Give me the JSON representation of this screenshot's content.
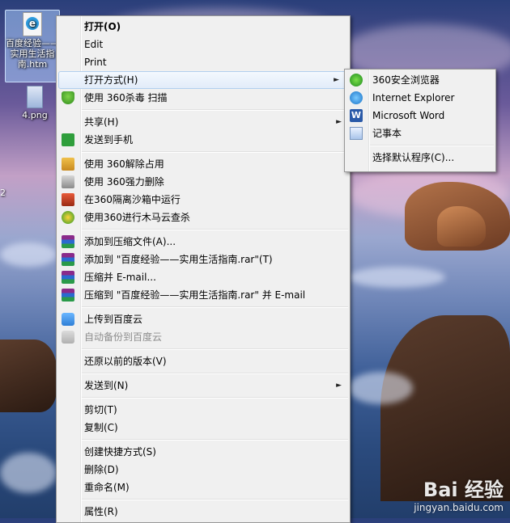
{
  "desktop": {
    "icons": [
      {
        "label": "百度经验——实用生活指南.htm",
        "icon": "html-file-icon",
        "selected": true
      },
      {
        "label": "4.png",
        "icon": "png-file-icon",
        "selected": false
      }
    ],
    "edge_text": "2"
  },
  "context_menu": {
    "items": [
      {
        "label": "打开(O)",
        "bold": true
      },
      {
        "label": "Edit"
      },
      {
        "label": "Print"
      },
      {
        "label": "打开方式(H)",
        "submenu": true
      },
      {
        "label": "使用 360杀毒 扫描",
        "icon": "360-shield-icon"
      },
      {
        "label": "共享(H)",
        "submenu": true
      },
      {
        "label": "发送到手机",
        "icon": "send-to-phone-icon"
      },
      {
        "label": "使用 360解除占用",
        "icon": "360-unlock-icon"
      },
      {
        "label": "使用 360强力删除",
        "icon": "360-force-delete-icon"
      },
      {
        "label": "在360隔离沙箱中运行",
        "icon": "360-sandbox-icon"
      },
      {
        "label": "使用360进行木马云查杀",
        "icon": "360-trojan-scan-icon"
      },
      {
        "label": "添加到压缩文件(A)...",
        "icon": "winrar-icon"
      },
      {
        "label": "添加到 \"百度经验——实用生活指南.rar\"(T)",
        "icon": "winrar-icon"
      },
      {
        "label": "压缩并 E-mail...",
        "icon": "winrar-icon"
      },
      {
        "label": "压缩到 \"百度经验——实用生活指南.rar\" 并 E-mail",
        "icon": "winrar-icon"
      },
      {
        "label": "上传到百度云",
        "icon": "baidu-cloud-icon"
      },
      {
        "label": "自动备份到百度云",
        "icon": "baidu-cloud-icon",
        "disabled": true
      },
      {
        "label": "还原以前的版本(V)"
      },
      {
        "label": "发送到(N)",
        "submenu": true
      },
      {
        "label": "剪切(T)"
      },
      {
        "label": "复制(C)"
      },
      {
        "label": "创建快捷方式(S)"
      },
      {
        "label": "删除(D)"
      },
      {
        "label": "重命名(M)"
      },
      {
        "label": "属性(R)"
      }
    ],
    "submenu_arrow": "►"
  },
  "open_with_menu": {
    "items": [
      {
        "label": "360安全浏览器",
        "icon": "360-browser-icon"
      },
      {
        "label": "Internet Explorer",
        "icon": "internet-explorer-icon"
      },
      {
        "label": "Microsoft Word",
        "icon": "microsoft-word-icon",
        "glyph": "W"
      },
      {
        "label": "记事本",
        "icon": "notepad-icon"
      },
      {
        "label": "选择默认程序(C)..."
      }
    ]
  },
  "watermark": {
    "logo": "Bai 经验",
    "url": "jingyan.baidu.com"
  }
}
